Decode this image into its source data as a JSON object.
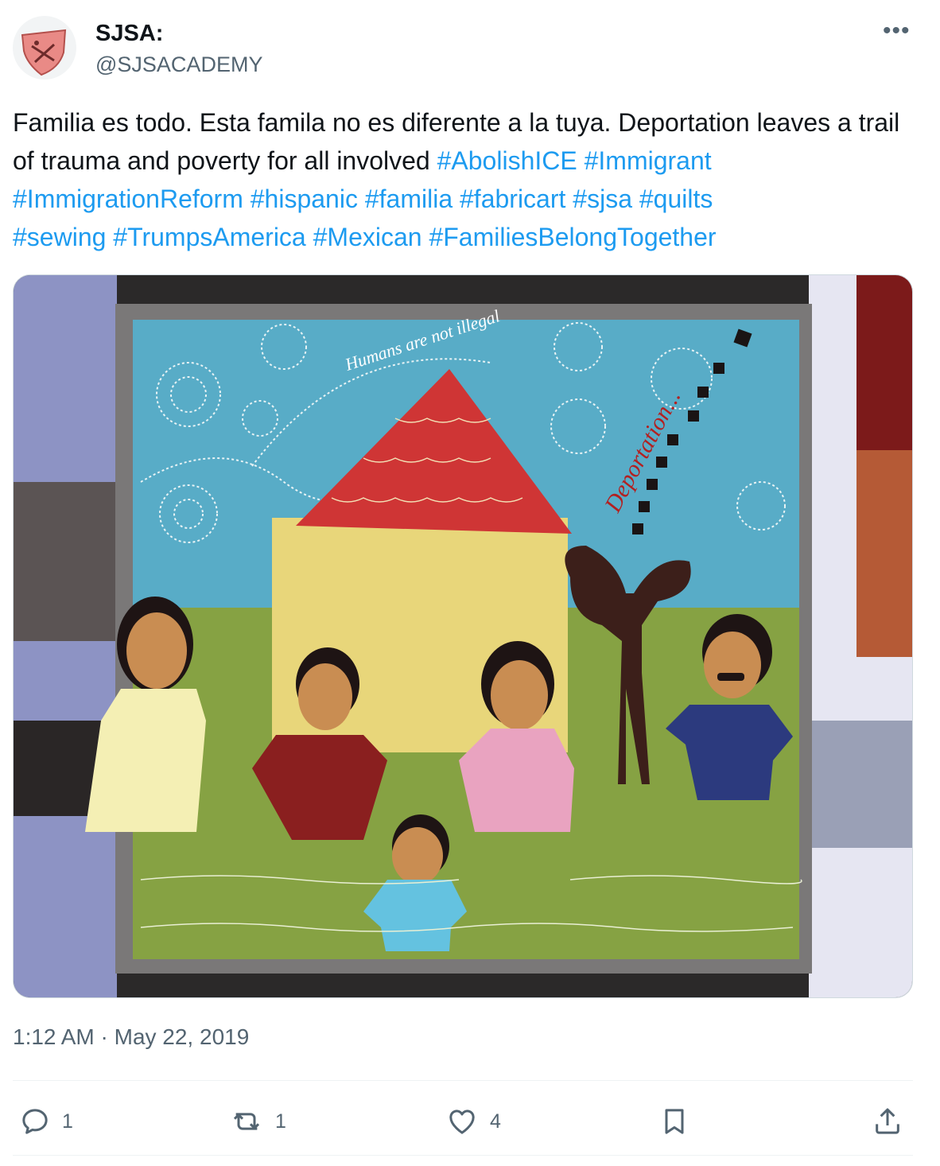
{
  "user": {
    "display_name": "SJSA:",
    "handle": "@SJSACADEMY",
    "avatar_icon": "shield-logo-icon"
  },
  "tweet": {
    "text": "Familia es todo. Esta famila no es diferente a la tuya. Deportation leaves a trail of trauma and poverty for all involved",
    "hashtags": [
      "#AbolishICE",
      "#Immigrant",
      "#ImmigrationReform",
      "#hispanic",
      "#familia",
      "#fabricart",
      "#sjsa",
      "#quilts",
      "#sewing",
      "#TrumpsAmerica",
      "#Mexican",
      "#FamiliesBelongTogether"
    ],
    "timestamp": "1:12 AM · May 22, 2019"
  },
  "media": {
    "quilt_text_1": "Humans are not illegal",
    "quilt_text_2": "Deportation..."
  },
  "actions": {
    "reply": {
      "icon": "reply-icon",
      "count": "1"
    },
    "retweet": {
      "icon": "retweet-icon",
      "count": "1"
    },
    "like": {
      "icon": "heart-icon",
      "count": "4"
    },
    "bookmark": {
      "icon": "bookmark-icon"
    },
    "share": {
      "icon": "share-icon"
    }
  },
  "colors": {
    "link": "#1d9bf0",
    "secondary_text": "#536471"
  }
}
